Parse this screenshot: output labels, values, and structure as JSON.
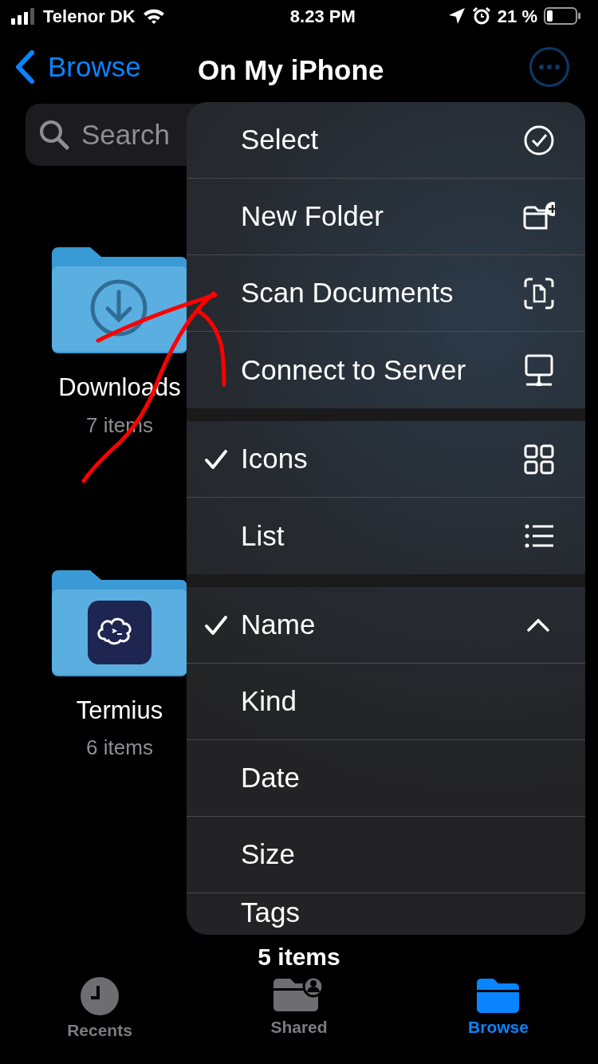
{
  "status_bar": {
    "carrier": "Telenor DK",
    "time": "8.23 PM",
    "battery": "21 %"
  },
  "nav": {
    "back": "Browse",
    "title": "On My iPhone"
  },
  "search": {
    "placeholder": "Search"
  },
  "folders": [
    {
      "name": "Downloads",
      "count": "7 items"
    },
    {
      "name": "Termius",
      "count": "6 items"
    }
  ],
  "menu": {
    "sections": [
      {
        "items": [
          {
            "label": "Select"
          },
          {
            "label": "New Folder"
          },
          {
            "label": "Scan Documents"
          },
          {
            "label": "Connect to Server"
          }
        ]
      },
      {
        "items": [
          {
            "label": "Icons",
            "checked": true
          },
          {
            "label": "List",
            "checked": false
          }
        ]
      },
      {
        "items": [
          {
            "label": "Name",
            "checked": true,
            "ascending": true
          },
          {
            "label": "Kind",
            "checked": false
          },
          {
            "label": "Date",
            "checked": false
          },
          {
            "label": "Size",
            "checked": false
          },
          {
            "label": "Tags",
            "checked": false
          }
        ]
      }
    ]
  },
  "footer": "5 items",
  "tabs": [
    {
      "label": "Recents",
      "selected": false
    },
    {
      "label": "Shared",
      "selected": false
    },
    {
      "label": "Browse",
      "selected": true
    }
  ]
}
